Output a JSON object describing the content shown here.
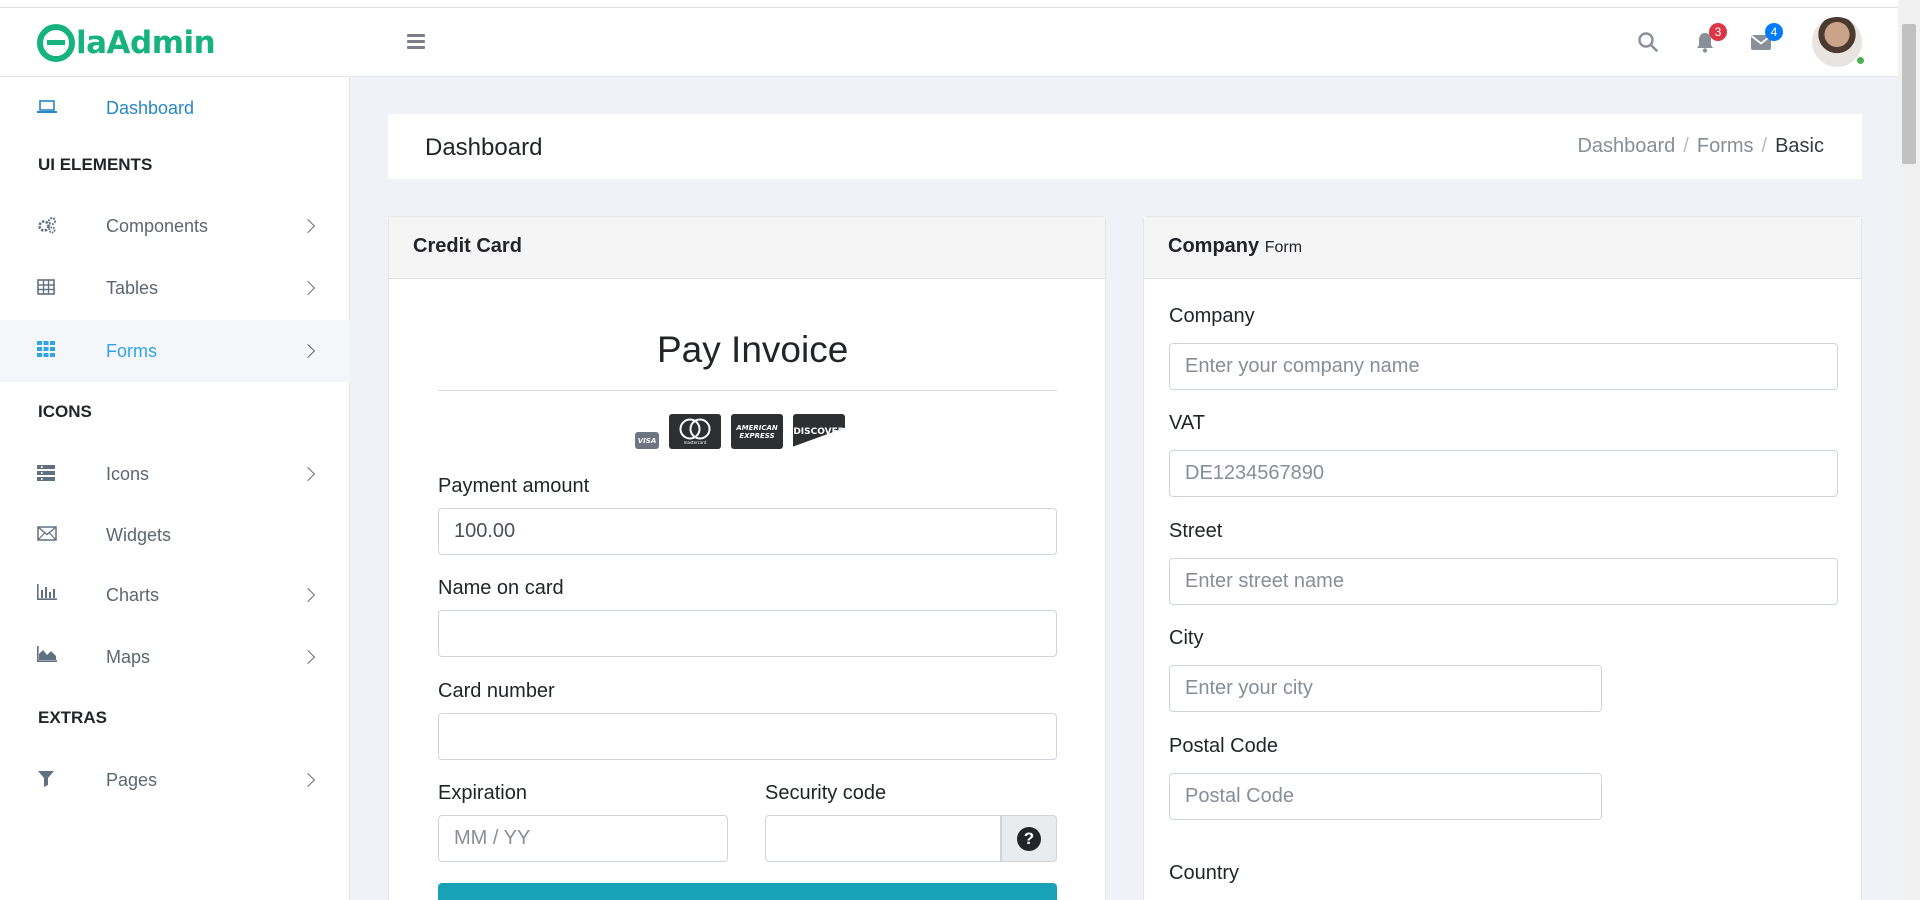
{
  "app": {
    "logo_text": "laAdmin"
  },
  "header": {
    "notification_count": "3",
    "message_count": "4",
    "colors": {
      "notif_badge": "#dc3545",
      "msg_badge": "#007bff"
    }
  },
  "sidebar": {
    "dashboard": "Dashboard",
    "section_ui": "UI ELEMENTS",
    "components": "Components",
    "tables": "Tables",
    "forms": "Forms",
    "section_icons": "ICONS",
    "icons": "Icons",
    "widgets": "Widgets",
    "charts": "Charts",
    "maps": "Maps",
    "section_extras": "EXTRAS",
    "pages": "Pages"
  },
  "page": {
    "title": "Dashboard",
    "breadcrumb": [
      "Dashboard",
      "Forms",
      "Basic"
    ]
  },
  "credit_card": {
    "header": "Credit Card",
    "title": "Pay Invoice",
    "card_brands": [
      "VISA",
      "mastercard",
      "AMERICAN EXPRESS",
      "DISCOVER"
    ],
    "payment_amount_label": "Payment amount",
    "payment_amount_value": "100.00",
    "name_label": "Name on card",
    "card_number_label": "Card number",
    "expiration_label": "Expiration",
    "expiration_placeholder": "MM / YY",
    "security_label": "Security code"
  },
  "company_form": {
    "header_bold": "Company",
    "header_small": "Form",
    "company_label": "Company",
    "company_placeholder": "Enter your company name",
    "vat_label": "VAT",
    "vat_placeholder": "DE1234567890",
    "street_label": "Street",
    "street_placeholder": "Enter street name",
    "city_label": "City",
    "city_placeholder": "Enter your city",
    "postal_label": "Postal Code",
    "postal_placeholder": "Postal Code",
    "country_label": "Country"
  }
}
